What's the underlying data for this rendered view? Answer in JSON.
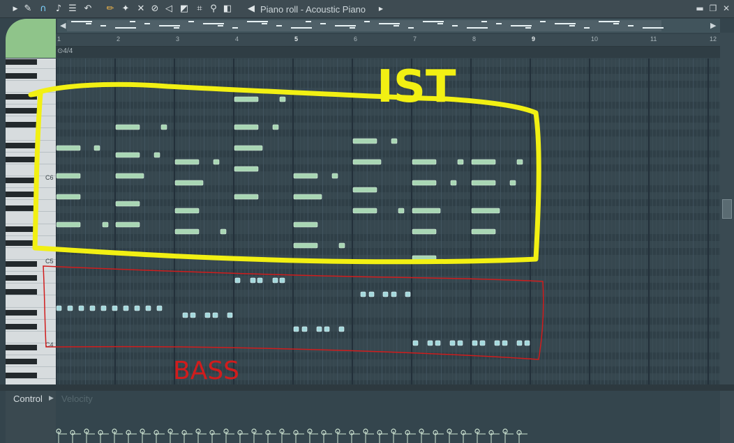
{
  "window": {
    "title": "Piano roll - Acoustic Piano"
  },
  "toolbar": {
    "icons": [
      "play-arrow-icon",
      "wrench-icon",
      "magnet-icon",
      "note-icon",
      "list-icon",
      "undo-icon",
      "pencil-icon",
      "paint-icon",
      "delete-icon",
      "mute-icon",
      "slice-icon",
      "select-icon",
      "zoom-icon",
      "playback-icon"
    ]
  },
  "ruler": {
    "bars": [
      "1",
      "2",
      "3",
      "4",
      "5",
      "6",
      "7",
      "8",
      "9",
      "10",
      "11",
      "12"
    ]
  },
  "time_signature": "4/4",
  "keyboard": {
    "labels": [
      "C6",
      "C5",
      "C4"
    ]
  },
  "control": {
    "label": "Control",
    "target": "Velocity"
  },
  "annotations": {
    "top": "IST",
    "bottom": "BASS",
    "top_color": "#f2f013",
    "bottom_color": "#d11c1c"
  },
  "colors": {
    "note": "#a9d6b4",
    "note_dark": "#7fb894",
    "bass_note": "#a4d8dc"
  }
}
